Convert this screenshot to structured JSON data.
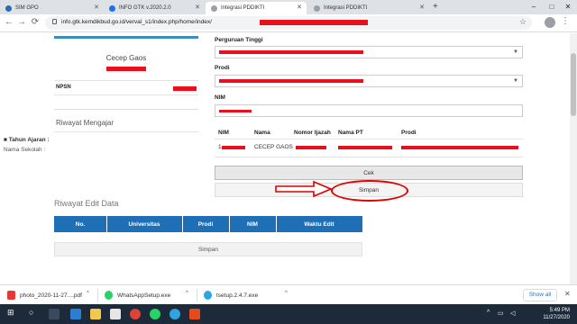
{
  "browser": {
    "tabs": [
      {
        "label": "SIM GPO",
        "color": "#2b6cb0"
      },
      {
        "label": "INFO GTK v.2020.2.0",
        "color": "#1a73e8"
      },
      {
        "label": "Integrasi PDDIKTI",
        "color": "#9aa0a6"
      },
      {
        "label": "Integrasi PDDIKTI",
        "color": "#9aa0a6"
      }
    ],
    "url": "info.gtk.kemdikbud.go.id/verval_s1/index.php/home/index/"
  },
  "profile": {
    "name": "Cecep Gaos",
    "npsn_label": "NPSN"
  },
  "riwayat_mengajar": {
    "title": "Riwayat Mengajar",
    "tahun_label": "Tahun Ajaran :",
    "sekolah_label": "Nama Sekolah :"
  },
  "form": {
    "perguruan_label": "Perguruan Tinggi",
    "prodi_label": "Prodi",
    "nim_label": "NIM",
    "result_table": {
      "headers": [
        "NIM",
        "Nama",
        "Nomor Ijazah",
        "Nama PT",
        "Prodi"
      ],
      "row": {
        "nim_prefix": "1",
        "nama": "CECEP GAOS"
      }
    },
    "cek_label": "Cek",
    "simpan_label": "Simpan"
  },
  "riwayat_edit": {
    "title": "Riwayat Edit Data",
    "headers": [
      "No.",
      "Universitas",
      "Prodi",
      "NIM",
      "Waktu Edit"
    ],
    "simpan_label": "Simpan"
  },
  "downloads": {
    "items": [
      {
        "label": "photo_2020-11-27....pdf",
        "color": "#e53935"
      },
      {
        "label": "WhatsAppSetup.exe",
        "color": "#25d366"
      },
      {
        "label": "tsetup.2.4.7.exe",
        "color": "#2ca5e0"
      }
    ],
    "show_all": "Show all"
  },
  "taskbar": {
    "time": "5:49 PM",
    "date": "11/27/2020"
  },
  "colors": {
    "accent_blue": "#1f6fb7",
    "redaction": "#e8101c",
    "annotation_red": "#e00000"
  }
}
